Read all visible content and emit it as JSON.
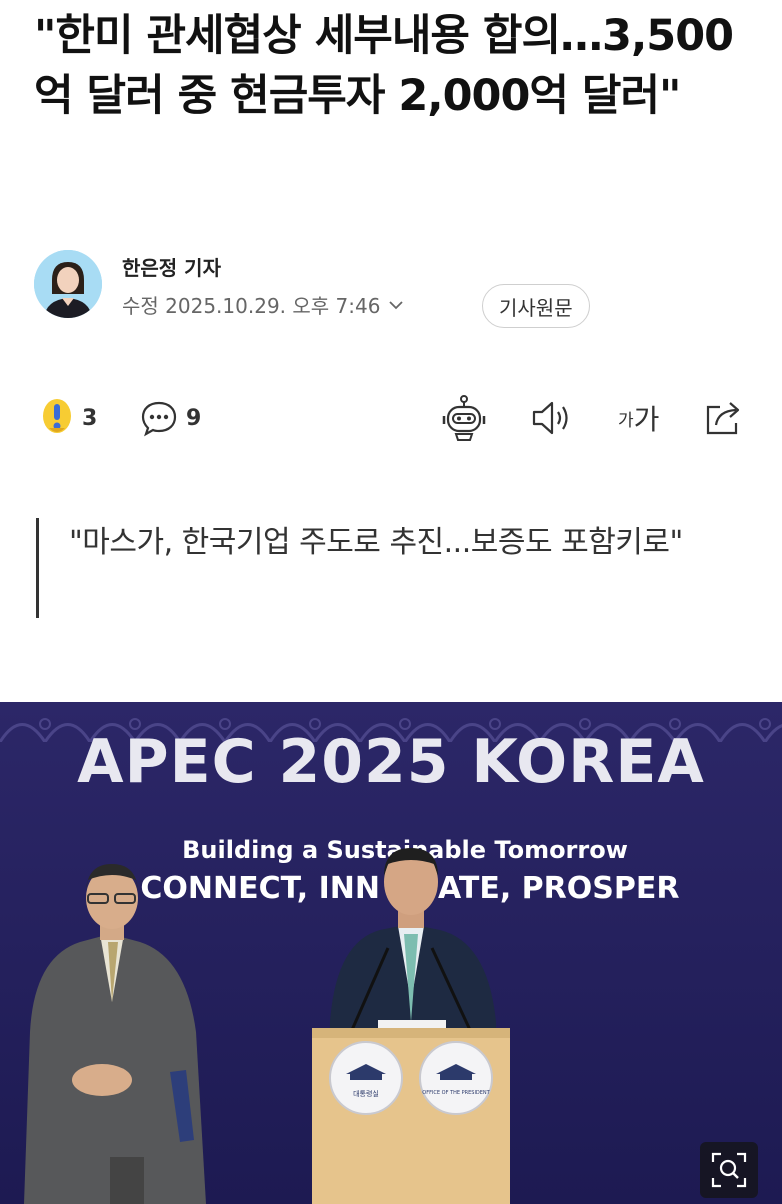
{
  "article": {
    "headline": "\"한미 관세협상 세부내용 합의…3,500억 달러 중 현금투자 2,000억 달러\"",
    "reporter": "한은정 기자",
    "meta": "수정 2025.10.29. 오후 7:46",
    "original_button": "기사원문",
    "subtitle": "\"마스가, 한국기업 주도로 추진...보증도 포함키로\""
  },
  "actions": {
    "reaction_count": "3",
    "comment_count": "9",
    "font_small": "가",
    "font_large": "가"
  },
  "photo": {
    "banner_title": "APEC 2025 KOREA",
    "banner_subtitle": "Building a Sustainable Tomorrow",
    "banner_slogan": "CONNECT, INN",
    "banner_slogan_end": "ATE, PROSPER",
    "podium_seal_left": "대통령실",
    "podium_seal_right": "OFFICE OF THE PRESIDENT",
    "bg_color": "#25205e",
    "banner_text_color": "#e8e8f0"
  },
  "icons": {
    "reaction": "exclamation-emoji-icon",
    "comment": "comment-bubble-icon",
    "summary_bot": "robot-icon",
    "tts": "speaker-icon",
    "font": "font-size-icon",
    "share": "share-icon",
    "zoom": "zoom-icon",
    "chevron": "chevron-down-icon"
  }
}
